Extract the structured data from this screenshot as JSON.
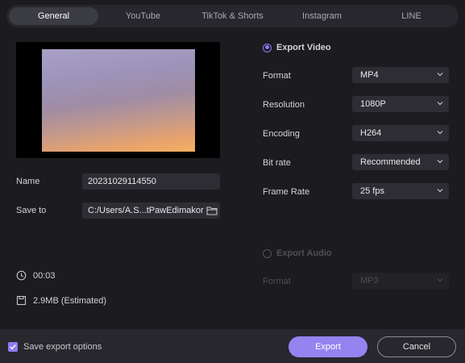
{
  "tabs": [
    {
      "label": "General",
      "active": true
    },
    {
      "label": "YouTube",
      "active": false
    },
    {
      "label": "TikTok & Shorts",
      "active": false
    },
    {
      "label": "Instagram",
      "active": false
    },
    {
      "label": "LINE",
      "active": false
    }
  ],
  "left": {
    "name_label": "Name",
    "name_value": "20231029114550",
    "save_label": "Save to",
    "save_value": "C:/Users/A.S...tPawEdimakor",
    "duration": "00:03",
    "size": "2.9MB (Estimated)"
  },
  "video": {
    "header": "Export Video",
    "selected": true,
    "rows": [
      {
        "label": "Format",
        "value": "MP4"
      },
      {
        "label": "Resolution",
        "value": "1080P"
      },
      {
        "label": "Encoding",
        "value": "H264"
      },
      {
        "label": "Bit rate",
        "value": "Recommended"
      },
      {
        "label": "Frame Rate",
        "value": "25  fps"
      }
    ]
  },
  "audio": {
    "header": "Export Audio",
    "selected": false,
    "rows": [
      {
        "label": "Format",
        "value": "MP3"
      }
    ]
  },
  "footer": {
    "save_options_label": "Save export options",
    "save_options_checked": true,
    "export_label": "Export",
    "cancel_label": "Cancel"
  },
  "colors": {
    "accent": "#8e7cf4",
    "export_button": "#9583f0",
    "background": "#1b1b20",
    "panel": "#27272d",
    "field": "#2d2d33"
  },
  "icons": {
    "folder": "folder-icon",
    "duration": "clock-icon",
    "size": "save-icon",
    "chevron": "chevron-down-icon",
    "check": "check-icon"
  }
}
